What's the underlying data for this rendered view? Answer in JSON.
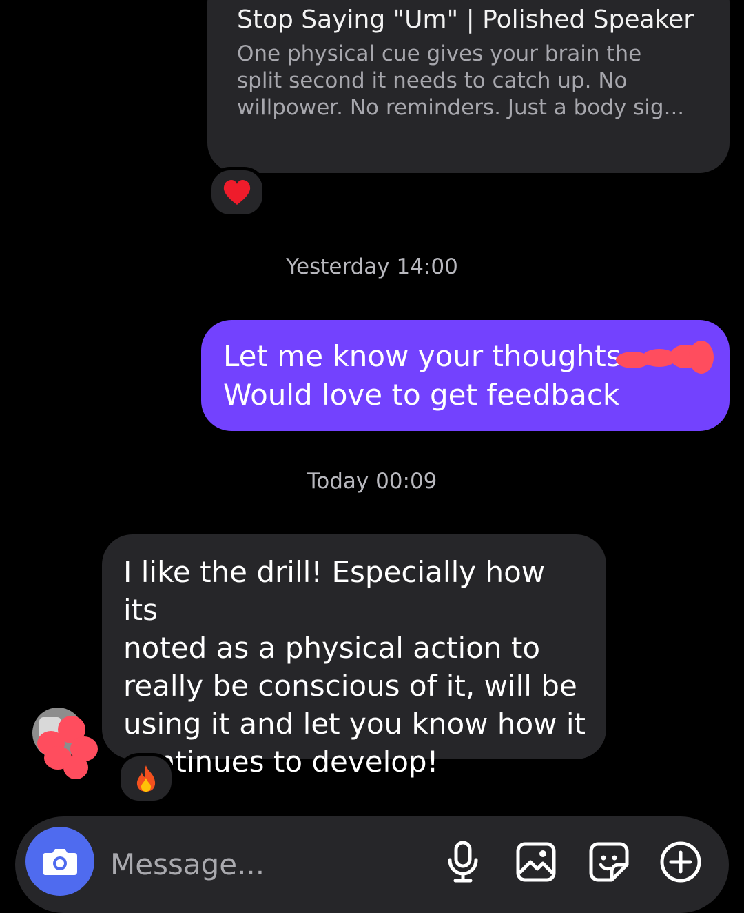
{
  "post": {
    "title": "Stop Saying \"Um\" | Polished Speaker",
    "description": "One physical cue gives your brain the\nsplit second it needs to catch up. No\nwillpower. No reminders. Just a body sig..."
  },
  "reactions": {
    "post_reaction": "❤️",
    "reply_reaction": "🔥"
  },
  "timestamps": {
    "first": "Yesterday 14:00",
    "second": "Today 00:09"
  },
  "messages": {
    "sent": "Let me know your thoughts\nWould love to get feedback",
    "received": "I like the drill! Especially how its\nnoted as a physical action to\nreally be conscious of it, will be\nusing it and let you know how it\ncontinues to develop!"
  },
  "composer": {
    "placeholder": "Message..."
  },
  "icons": [
    "camera-icon",
    "microphone-icon",
    "gallery-icon",
    "sticker-icon",
    "plus-icon"
  ],
  "colors": {
    "sent_bubble": "#7342fe",
    "received_bubble": "#262629",
    "camera_button": "#4f6bef",
    "redaction": "#ff4d5e"
  }
}
